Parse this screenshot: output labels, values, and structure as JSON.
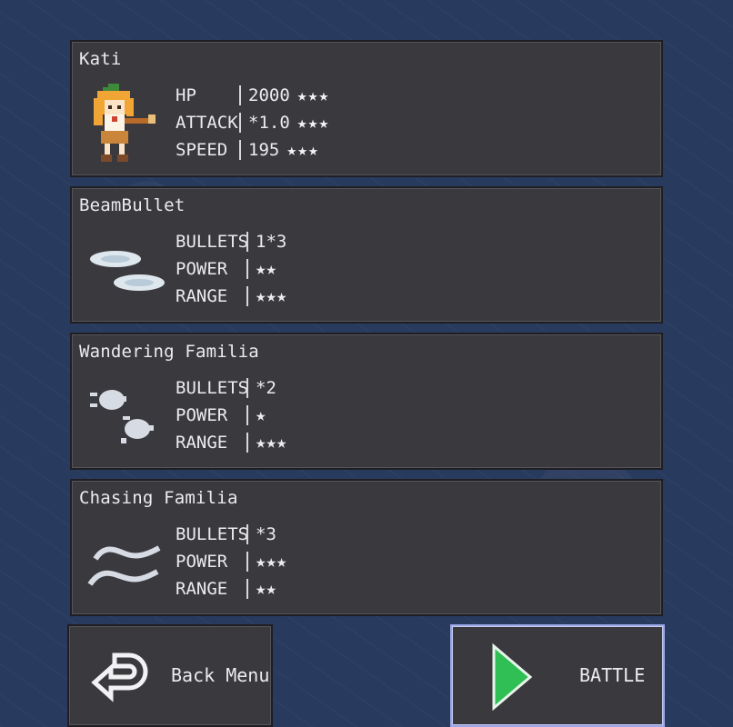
{
  "character": {
    "name": "Kati",
    "stats": [
      {
        "label": "HP",
        "value": "2000",
        "stars": "★★★"
      },
      {
        "label": "ATTACK",
        "value": "*1.0",
        "stars": "★★★"
      },
      {
        "label": "SPEED",
        "value": "195",
        "stars": "★★★"
      }
    ]
  },
  "weapons": [
    {
      "name": "BeamBullet",
      "icon": "beam-bullet-icon",
      "stats": [
        {
          "label": "BULLETS",
          "value": "1*3"
        },
        {
          "label": "POWER",
          "value": "★★"
        },
        {
          "label": "RANGE",
          "value": "★★★"
        }
      ]
    },
    {
      "name": "Wandering Familia",
      "icon": "wandering-familia-icon",
      "stats": [
        {
          "label": "BULLETS",
          "value": "*2"
        },
        {
          "label": "POWER",
          "value": "★"
        },
        {
          "label": "RANGE",
          "value": "★★★"
        }
      ]
    },
    {
      "name": "Chasing Familia",
      "icon": "chasing-familia-icon",
      "stats": [
        {
          "label": "BULLETS",
          "value": "*3"
        },
        {
          "label": "POWER",
          "value": "★★★"
        },
        {
          "label": "RANGE",
          "value": "★★"
        }
      ]
    }
  ],
  "buttons": {
    "back_label": "Back Menu",
    "battle_label": "BATTLE"
  },
  "colors": {
    "background": "#283a5e",
    "panel": "#3a393e",
    "battle_arrow": "#2fbf55",
    "battle_border": "#9aa6e6"
  }
}
